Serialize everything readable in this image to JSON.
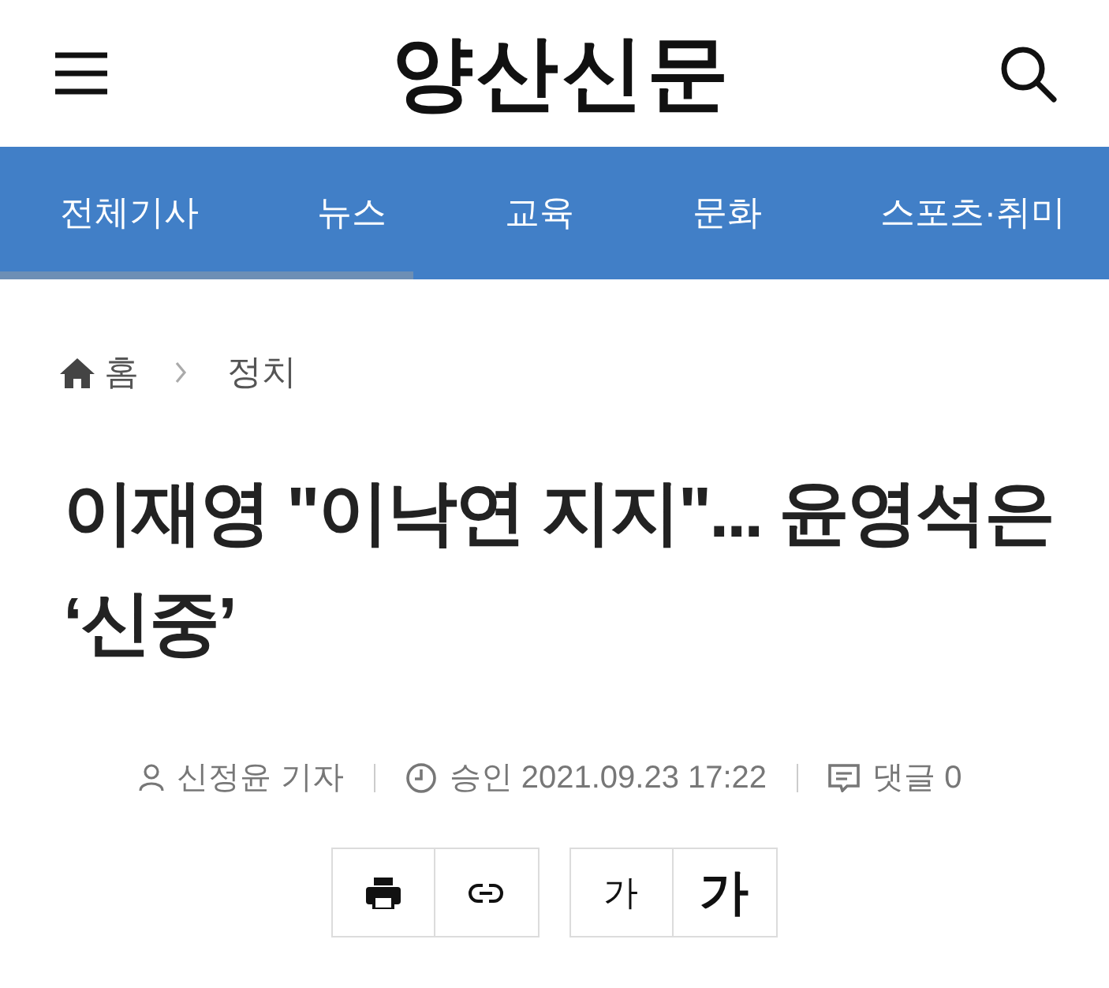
{
  "header": {
    "logo": "양산신문"
  },
  "nav": {
    "items": [
      {
        "label": "전체기사"
      },
      {
        "label": "뉴스"
      },
      {
        "label": "교육"
      },
      {
        "label": "문화"
      },
      {
        "label": "스포츠·취미"
      }
    ]
  },
  "breadcrumb": [
    {
      "kind": "home",
      "label": "홈"
    },
    {
      "kind": "section",
      "label": "정치"
    }
  ],
  "article": {
    "title": "이재영 \"이낙연 지지\"... 윤영석은 ‘신중’",
    "meta": [
      {
        "kind": "author",
        "text": "신정윤 기자"
      },
      {
        "kind": "approved",
        "text": "승인 2021.09.23 17:22"
      },
      {
        "kind": "comments",
        "text": "댓글 0"
      }
    ]
  },
  "tools": [
    [
      {
        "kind": "print"
      },
      {
        "kind": "link"
      }
    ],
    [
      {
        "kind": "font-smaller",
        "label": "가"
      },
      {
        "kind": "font-larger",
        "label": "가"
      }
    ]
  ]
}
